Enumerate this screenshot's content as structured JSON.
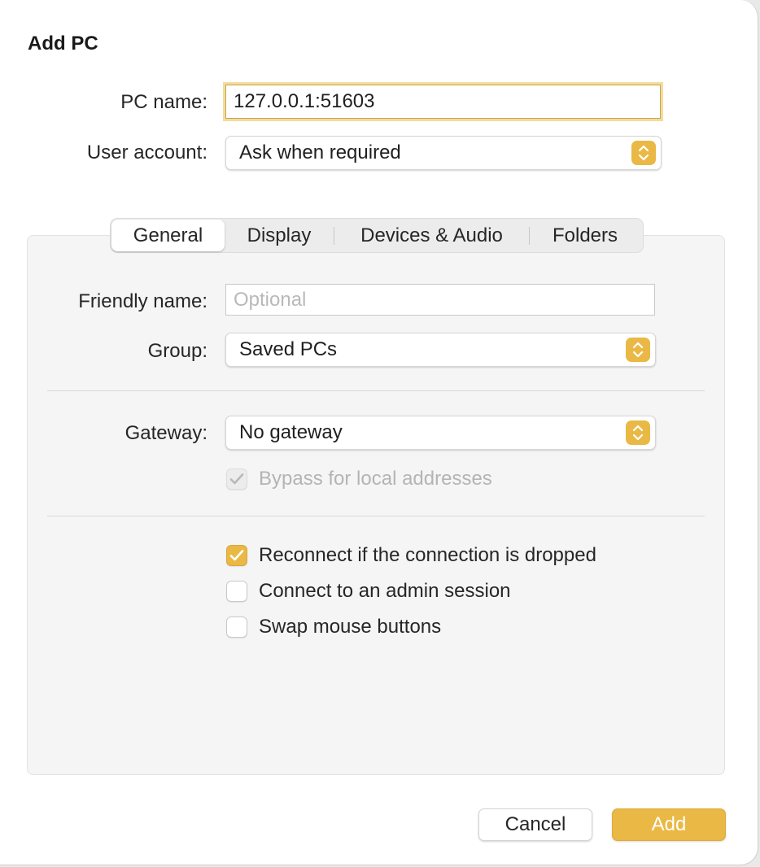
{
  "dialog": {
    "title": "Add PC"
  },
  "pc_name": {
    "label": "PC name:",
    "value": "127.0.0.1:51603"
  },
  "user_account": {
    "label": "User account:",
    "value": "Ask when required"
  },
  "tabs": [
    {
      "label": "General",
      "active": true
    },
    {
      "label": "Display",
      "active": false
    },
    {
      "label": "Devices & Audio",
      "active": false
    },
    {
      "label": "Folders",
      "active": false
    }
  ],
  "general": {
    "friendly_name": {
      "label": "Friendly name:",
      "placeholder": "Optional",
      "value": ""
    },
    "group": {
      "label": "Group:",
      "value": "Saved PCs"
    },
    "gateway": {
      "label": "Gateway:",
      "value": "No gateway"
    },
    "bypass": {
      "label": "Bypass for local addresses",
      "checked": true,
      "disabled": true
    },
    "options": [
      {
        "label": "Reconnect if the connection is dropped",
        "checked": true
      },
      {
        "label": "Connect to an admin session",
        "checked": false
      },
      {
        "label": "Swap mouse buttons",
        "checked": false
      }
    ]
  },
  "buttons": {
    "cancel": "Cancel",
    "add": "Add"
  },
  "colors": {
    "accent": "#eab844",
    "focus_ring": "#f3dc9c",
    "panel_bg": "#f5f5f5"
  },
  "icons": {
    "stepper": "chevron-up-down-icon",
    "checkmark": "checkmark-icon"
  }
}
